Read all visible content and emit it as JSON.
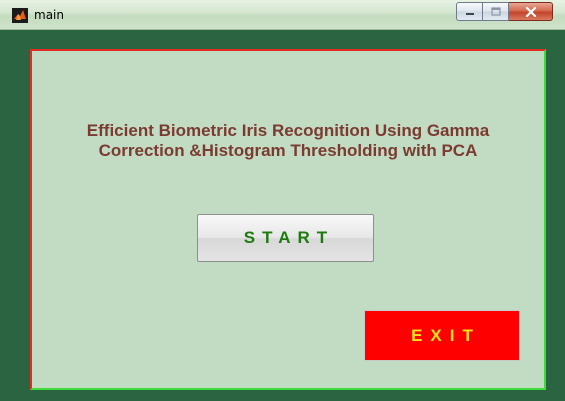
{
  "window": {
    "title": "main",
    "app_icon": "matlab-icon",
    "caption_buttons": {
      "minimize_icon": "minimize-icon",
      "maximize_icon": "maximize-icon",
      "close_icon": "close-icon"
    }
  },
  "main": {
    "heading": "Efficient Biometric Iris Recognition Using Gamma\nCorrection &Histogram Thresholding with PCA",
    "start_label": "START",
    "exit_label": "EXIT"
  },
  "colors": {
    "panel_background": "#c1dcc2",
    "window_background": "#2b6440",
    "heading_text": "#7b3b31",
    "start_text": "#1f7a12",
    "exit_background": "#ff0000",
    "exit_text": "#f5e51a"
  }
}
